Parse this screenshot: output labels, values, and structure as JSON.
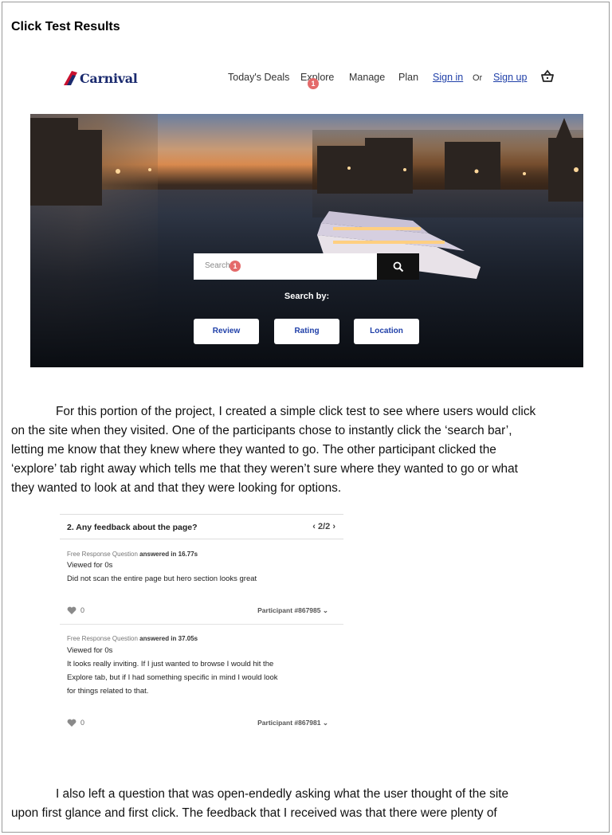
{
  "document": {
    "title": "Click Test Results"
  },
  "site": {
    "logo_text": "Carnival",
    "nav": {
      "todays_deals": "Today's Deals",
      "explore": "Explore",
      "manage": "Manage",
      "plan": "Plan",
      "sign_in": "Sign in",
      "or": "Or",
      "sign_up": "Sign up"
    },
    "click_marker": "1",
    "search": {
      "placeholder": "Search",
      "marker": "1"
    },
    "search_by": "Search by:",
    "filters": [
      "Review",
      "Rating",
      "Location"
    ],
    "colors": {
      "brand_blue": "#1a2a6e",
      "marker_red": "#e46a6a"
    }
  },
  "paragraph1": {
    "lines": [
      "For this portion of the project, I created a simple click test to see where users would click",
      "on the site when they visited. One of the participants chose to instantly click the ‘search bar’,",
      "letting me know that they knew where they wanted to go. The other participant clicked the",
      "‘explore’ tab right away which tells me that they weren’t sure where they wanted to go or what",
      "they wanted to look at and that they were looking for options."
    ]
  },
  "feedback": {
    "question": "2. Any feedback about the page?",
    "pager": "‹ 2/2 ›",
    "responses": [
      {
        "type": "Free Response Question",
        "answered": "answered in 16.77s",
        "viewed": "Viewed for 0s",
        "text": [
          "Did not scan the entire page but hero section looks great"
        ],
        "likes": "0",
        "participant": "Participant #867985"
      },
      {
        "type": "Free Response Question",
        "answered": "answered in 37.05s",
        "viewed": "Viewed for 0s",
        "text": [
          "It looks really inviting. If I just wanted to browse I would hit the",
          "Explore tab, but if I had something specific in mind I would look",
          "for things related to that."
        ],
        "likes": "0",
        "participant": "Participant #867981"
      }
    ]
  },
  "paragraph2": {
    "lines": [
      "I also left a question that was open-endedly asking what the user thought of the site",
      "upon first glance and first click. The feedback that I received was that there were plenty of"
    ]
  }
}
